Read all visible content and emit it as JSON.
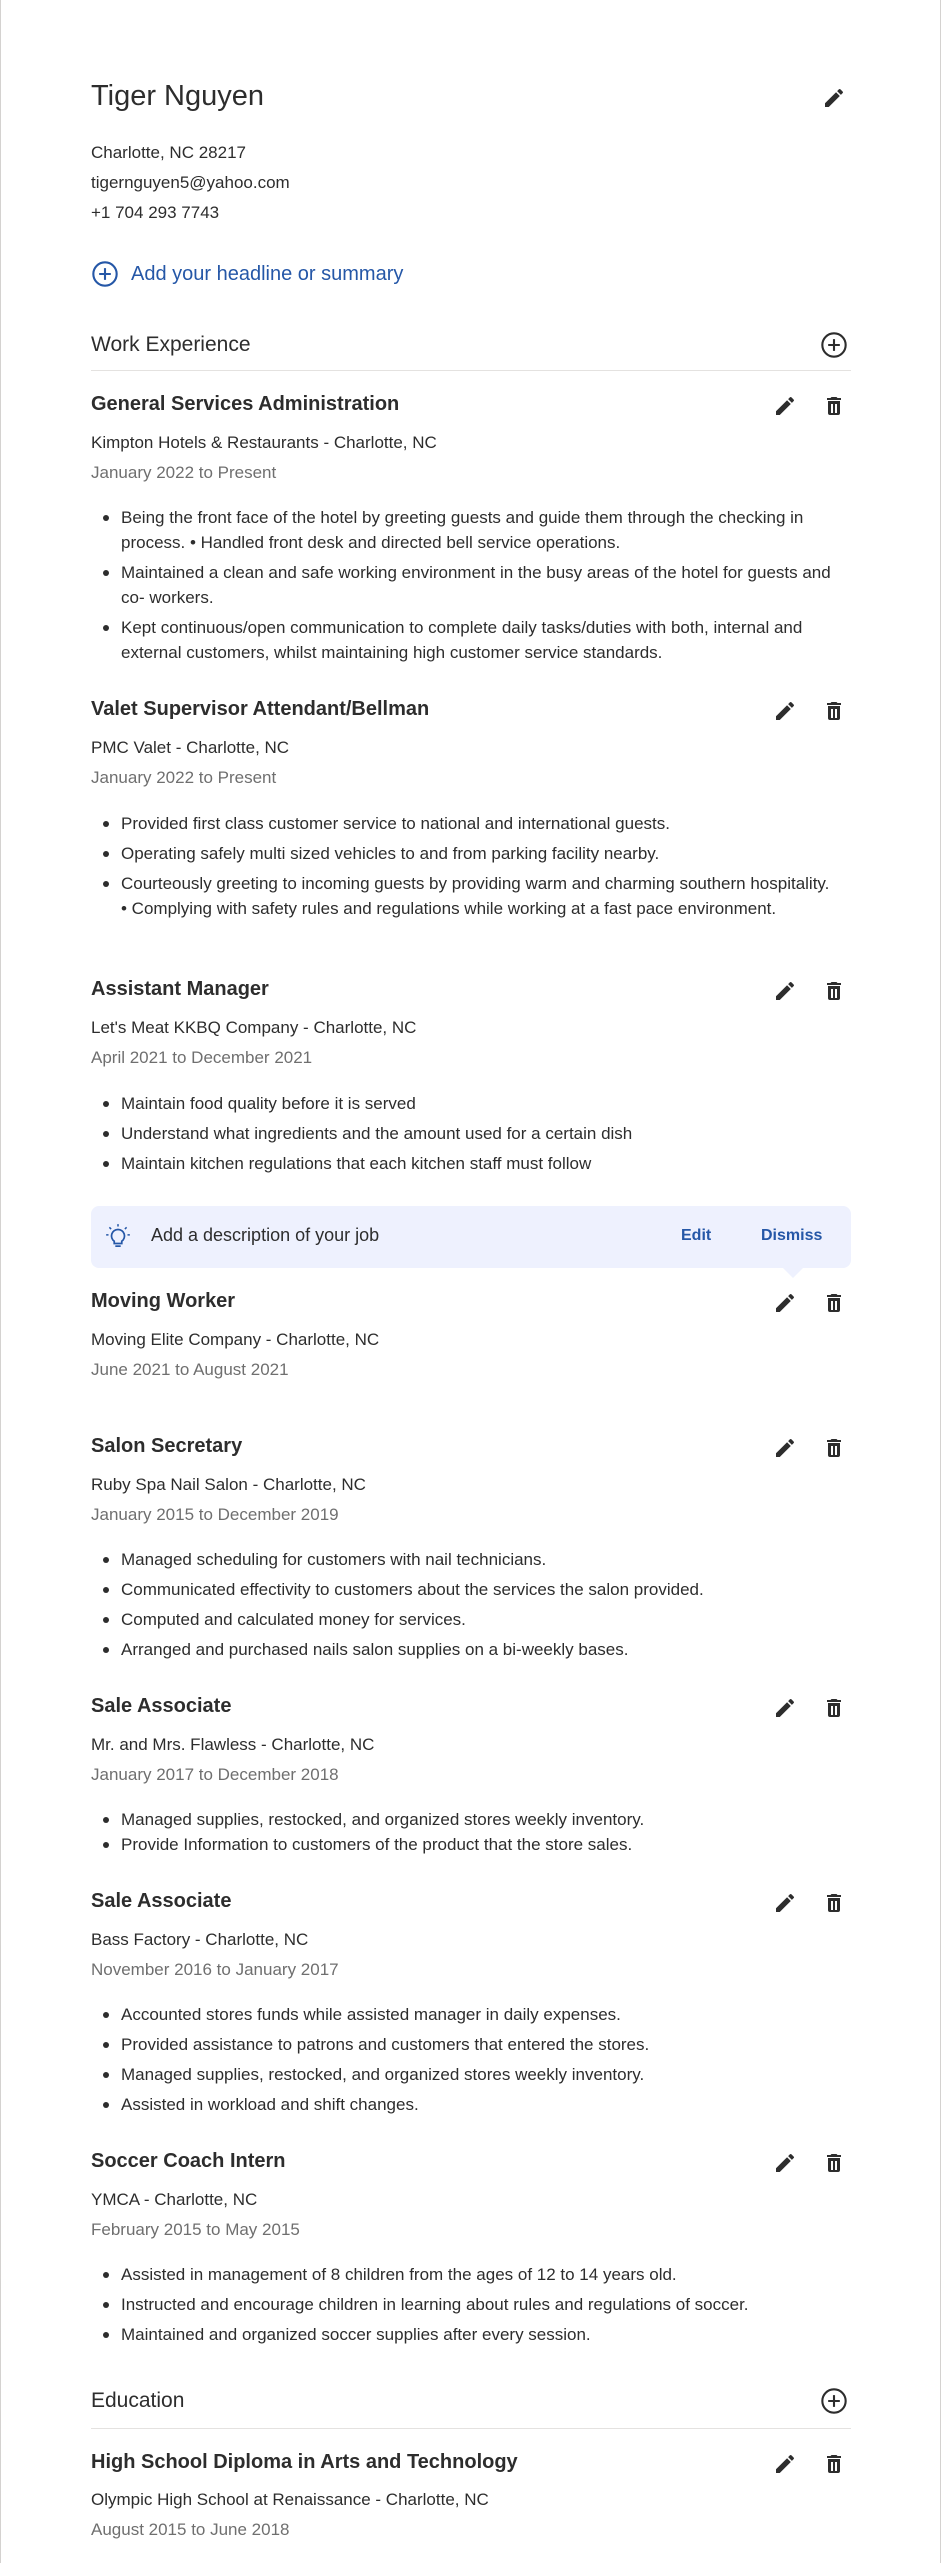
{
  "profile": {
    "name": "Tiger Nguyen",
    "location": "Charlotte, NC 28217",
    "email": "tigernguyen5@yahoo.com",
    "phone": "+1 704 293 7743",
    "headline_link": "Add your headline or summary"
  },
  "sections": {
    "work_experience": "Work Experience",
    "education": "Education"
  },
  "jobs": [
    {
      "title": "General Services Administration",
      "company": "Kimpton Hotels & Restaurants - Charlotte, NC",
      "dates": "January 2022 to Present",
      "bullets": [
        "Being the front face of the hotel by greeting guests and guide them through the checking in process. • Handled front desk and directed bell service operations.",
        "Maintained a clean and safe working environment in the busy areas of the hotel for guests and co- workers.",
        "Kept continuous/open communication to complete daily tasks/duties with both, internal and external customers, whilst maintaining high customer service standards."
      ]
    },
    {
      "title": "Valet Supervisor Attendant/Bellman",
      "company": "PMC Valet - Charlotte, NC",
      "dates": "January 2022 to Present",
      "bullets": [
        "Provided first class customer service to national and international guests.",
        "Operating safely multi sized vehicles to and from parking facility nearby.",
        "Courteously greeting to incoming guests by providing warm and charming southern hospitality. • Complying with safety rules and regulations while working at a fast pace environment."
      ]
    },
    {
      "title": "Assistant Manager",
      "company": "Let's Meat KKBQ Company - Charlotte, NC",
      "dates": "April 2021 to December 2021",
      "bullets": [
        "Maintain food quality before it is served",
        "Understand what ingredients and the amount used for a certain dish",
        "Maintain kitchen regulations that each kitchen staff must follow"
      ]
    },
    {
      "title": "Moving Worker",
      "company": "Moving Elite Company - Charlotte, NC",
      "dates": "June 2021 to August 2021",
      "bullets": []
    },
    {
      "title": "Salon Secretary",
      "company": "Ruby Spa Nail Salon - Charlotte, NC",
      "dates": "January 2015 to December 2019",
      "bullets": [
        "Managed scheduling for customers with nail technicians.",
        "Communicated effectivity to customers about the services the salon provided.",
        "Computed and calculated money for services.",
        "Arranged and purchased nails salon supplies on a bi-weekly bases."
      ]
    },
    {
      "title": "Sale Associate",
      "company": "Mr. and Mrs. Flawless - Charlotte, NC",
      "dates": "January 2017 to December 2018",
      "bullets": [
        "Managed supplies, restocked, and organized stores weekly inventory.",
        "Provide Information to customers of the product that the store sales."
      ]
    },
    {
      "title": "Sale Associate",
      "company": "Bass Factory - Charlotte, NC",
      "dates": "November 2016 to January 2017",
      "bullets": [
        "Accounted stores funds while assisted manager in daily expenses.",
        "Provided assistance to patrons and customers that entered the stores.",
        "Managed supplies, restocked, and organized stores weekly inventory.",
        "Assisted in workload and shift changes."
      ]
    },
    {
      "title": "Soccer Coach Intern",
      "company": "YMCA - Charlotte, NC",
      "dates": "February 2015 to May 2015",
      "bullets": [
        "Assisted in management of 8 children from the ages of 12 to 14 years old.",
        "Instructed and encourage children in learning about rules and regulations of soccer.",
        "Maintained and organized soccer supplies after every session."
      ]
    }
  ],
  "tip": {
    "text": "Add a description of your job",
    "edit": "Edit",
    "dismiss": "Dismiss"
  },
  "education": [
    {
      "title": "High School Diploma in Arts and Technology",
      "school": "Olympic High School at Renaissance - Charlotte, NC",
      "dates": "August 2015 to June 2018"
    }
  ],
  "icons": {
    "edit": "pencil-icon",
    "delete": "trash-icon",
    "add": "plus-circle-icon",
    "tip": "lightbulb-icon"
  },
  "colors": {
    "link_blue": "#2557a7",
    "tip_background": "#eef1fe",
    "text": "#2d2d2d",
    "muted": "#6f6f6f"
  }
}
